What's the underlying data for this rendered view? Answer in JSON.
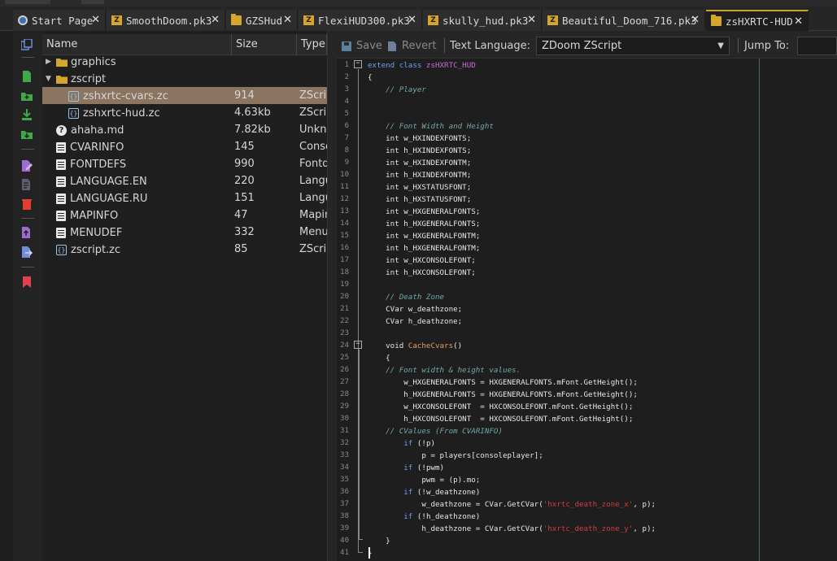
{
  "tabs": [
    {
      "label": "Start Page",
      "icon": "home-icon"
    },
    {
      "label": "SmoothDoom.pk3",
      "icon": "pk3-icon"
    },
    {
      "label": "GZSHud",
      "icon": "folder-icon"
    },
    {
      "label": "FlexiHUD300.pk3",
      "icon": "pk3-icon"
    },
    {
      "label": "skully_hud.pk3",
      "icon": "pk3-icon"
    },
    {
      "label": "Beautiful_Doom_716.pk3",
      "icon": "pk3-icon"
    },
    {
      "label": "zsHXRTC-HUD",
      "icon": "folder-icon",
      "active": true
    }
  ],
  "tab_close_glyph": "✕",
  "tree": {
    "headers": {
      "name": "Name",
      "size": "Size",
      "type": "Type"
    },
    "rows": [
      {
        "name": "graphics",
        "size": "",
        "type": "",
        "icon": "folder-icon",
        "indent": 0,
        "expander": "▶"
      },
      {
        "name": "zscript",
        "size": "",
        "type": "",
        "icon": "folder-icon",
        "indent": 0,
        "expander": "▼"
      },
      {
        "name": "zshxrtc-cvars.zc",
        "size": "914",
        "type": "ZScri",
        "icon": "zscript-file-icon",
        "indent": 1,
        "selected": true
      },
      {
        "name": "zshxrtc-hud.zc",
        "size": "4.63kb",
        "type": "ZScri",
        "icon": "zscript-file-icon",
        "indent": 1
      },
      {
        "name": "ahaha.md",
        "size": "7.82kb",
        "type": "Unkno",
        "icon": "help-file-icon",
        "indent": 0
      },
      {
        "name": "CVARINFO",
        "size": "145",
        "type": "Conso",
        "icon": "text-file-icon",
        "indent": 0
      },
      {
        "name": "FONTDEFS",
        "size": "990",
        "type": "Fontd",
        "icon": "text-file-icon",
        "indent": 0
      },
      {
        "name": "LANGUAGE.EN",
        "size": "220",
        "type": "Langu",
        "icon": "text-file-icon",
        "indent": 0
      },
      {
        "name": "LANGUAGE.RU",
        "size": "151",
        "type": "Langu",
        "icon": "text-file-icon",
        "indent": 0
      },
      {
        "name": "MAPINFO",
        "size": "47",
        "type": "Mapin",
        "icon": "text-file-icon",
        "indent": 0
      },
      {
        "name": "MENUDEF",
        "size": "332",
        "type": "Menu",
        "icon": "text-file-icon",
        "indent": 0
      },
      {
        "name": "zscript.zc",
        "size": "85",
        "type": "ZScri",
        "icon": "zscript-file-icon",
        "indent": 0
      }
    ]
  },
  "editor_toolbar": {
    "save_label": "Save",
    "revert_label": "Revert",
    "text_language_label": "Text Language:",
    "language_value": "ZDoom ZScript",
    "jump_to_label": "Jump To:",
    "jump_to_value": ""
  },
  "colors": {
    "keyword": "#6a9ff0",
    "comment": "#6fa8a8",
    "string": "#d23c3c",
    "class_name": "#c86bd8",
    "function": "#e0a060",
    "selection": "#8b7560",
    "active_tab_accent": "#c9a227"
  },
  "code_lines": [
    [
      [
        "kw",
        "extend class "
      ],
      [
        "cls",
        "zsHXRTC_HUD"
      ]
    ],
    [
      [
        "t",
        "{"
      ]
    ],
    [
      [
        "t",
        "    "
      ],
      [
        "cm",
        "// Player"
      ]
    ],
    [
      [
        "t",
        ""
      ]
    ],
    [
      [
        "t",
        ""
      ]
    ],
    [
      [
        "t",
        "    "
      ],
      [
        "cm",
        "// Font Width and Height"
      ]
    ],
    [
      [
        "t",
        "    int w_HXINDEXFONTS;"
      ]
    ],
    [
      [
        "t",
        "    int h_HXINDEXFONTS;"
      ]
    ],
    [
      [
        "t",
        "    int w_HXINDEXFONTM;"
      ]
    ],
    [
      [
        "t",
        "    int h_HXINDEXFONTM;"
      ]
    ],
    [
      [
        "t",
        "    int w_HXSTATUSFONT;"
      ]
    ],
    [
      [
        "t",
        "    int h_HXSTATUSFONT;"
      ]
    ],
    [
      [
        "t",
        "    int w_HXGENERALFONTS;"
      ]
    ],
    [
      [
        "t",
        "    int h_HXGENERALFONTS;"
      ]
    ],
    [
      [
        "t",
        "    int w_HXGENERALFONTM;"
      ]
    ],
    [
      [
        "t",
        "    int h_HXGENERALFONTM;"
      ]
    ],
    [
      [
        "t",
        "    int w_HXCONSOLEFONT;"
      ]
    ],
    [
      [
        "t",
        "    int h_HXCONSOLEFONT;"
      ]
    ],
    [
      [
        "t",
        ""
      ]
    ],
    [
      [
        "t",
        "    "
      ],
      [
        "cm",
        "// Death Zone"
      ]
    ],
    [
      [
        "t",
        "    CVar w_deathzone;"
      ]
    ],
    [
      [
        "t",
        "    CVar h_deathzone;"
      ]
    ],
    [
      [
        "t",
        ""
      ]
    ],
    [
      [
        "t",
        "    void "
      ],
      [
        "fn",
        "CacheCvars"
      ],
      [
        "t",
        "()"
      ]
    ],
    [
      [
        "t",
        "    {"
      ]
    ],
    [
      [
        "t",
        "    "
      ],
      [
        "cm",
        "// Font width & height values."
      ]
    ],
    [
      [
        "t",
        "        w_HXGENERALFONTS = HXGENERALFONTS.mFont.GetHeight();"
      ]
    ],
    [
      [
        "t",
        "        h_HXGENERALFONTS = HXGENERALFONTS.mFont.GetHeight();"
      ]
    ],
    [
      [
        "t",
        "        w_HXCONSOLEFONT  = HXCONSOLEFONT.mFont.GetHeight();"
      ]
    ],
    [
      [
        "t",
        "        h_HXCONSOLEFONT  = HXCONSOLEFONT.mFont.GetHeight();"
      ]
    ],
    [
      [
        "t",
        "    "
      ],
      [
        "cm",
        "// CValues (From CVARINFO)"
      ]
    ],
    [
      [
        "t",
        "        "
      ],
      [
        "kw",
        "if"
      ],
      [
        "t",
        " (!p)"
      ]
    ],
    [
      [
        "t",
        "            p = players[consoleplayer];"
      ]
    ],
    [
      [
        "t",
        "        "
      ],
      [
        "kw",
        "if"
      ],
      [
        "t",
        " (!pwm)"
      ]
    ],
    [
      [
        "t",
        "            pwm = (p).mo;"
      ]
    ],
    [
      [
        "t",
        "        "
      ],
      [
        "kw",
        "if"
      ],
      [
        "t",
        " (!w_deathzone)"
      ]
    ],
    [
      [
        "t",
        "            w_deathzone = CVar.GetCVar("
      ],
      [
        "st",
        "'hxrtc_death_zone_x'"
      ],
      [
        "t",
        ", p);"
      ]
    ],
    [
      [
        "t",
        "        "
      ],
      [
        "kw",
        "if"
      ],
      [
        "t",
        " (!h_deathzone)"
      ]
    ],
    [
      [
        "t",
        "            h_deathzone = CVar.GetCVar("
      ],
      [
        "st",
        "'hxrtc_death_zone_y'"
      ],
      [
        "t",
        ", p);"
      ]
    ],
    [
      [
        "t",
        "    }"
      ]
    ],
    [
      [
        "t",
        "}"
      ]
    ]
  ],
  "line_numbers": [
    1,
    2,
    3,
    4,
    5,
    6,
    7,
    8,
    9,
    10,
    11,
    12,
    13,
    14,
    15,
    16,
    17,
    18,
    19,
    20,
    21,
    22,
    23,
    24,
    25,
    26,
    27,
    28,
    29,
    30,
    31,
    32,
    33,
    34,
    35,
    36,
    37,
    38,
    39,
    40,
    41
  ]
}
